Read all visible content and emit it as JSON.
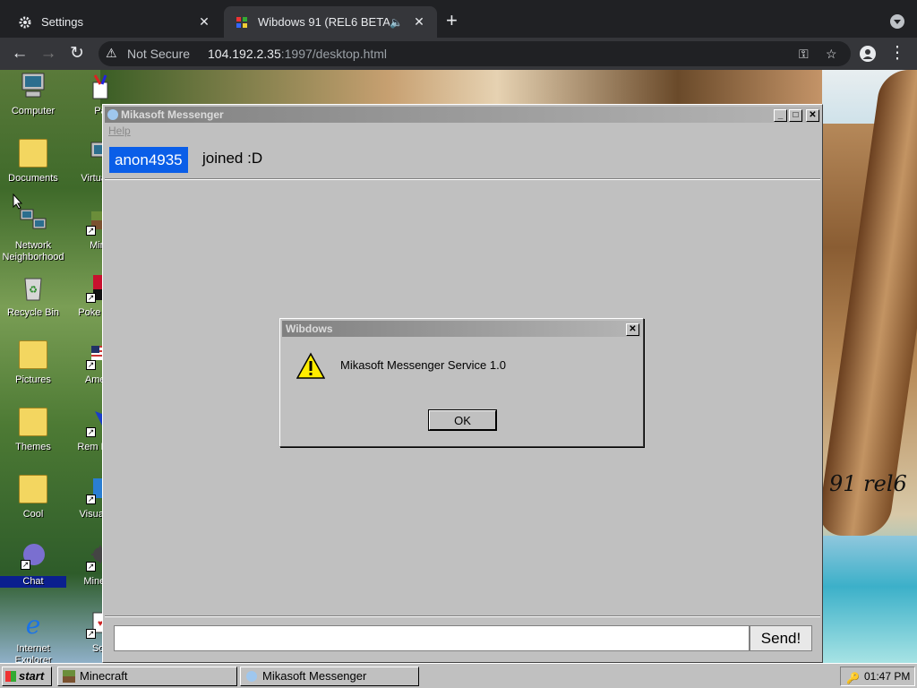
{
  "browser": {
    "tabs": [
      {
        "title": "Settings",
        "icon": "gear-icon"
      },
      {
        "title": "Wibdows 91 (REL6 BETA!)",
        "icon": "favicon-icon"
      }
    ],
    "security_label": "Not Secure",
    "url_host": "104.192.2.35",
    "url_rest": ":1997/desktop.html"
  },
  "desktop": {
    "brand_text": "91 rel6",
    "icons_col1": [
      {
        "label": "Computer",
        "selected": false
      },
      {
        "label": "Documents",
        "selected": false
      },
      {
        "label": "Network Neighborhood",
        "selected": false
      },
      {
        "label": "Recycle Bin",
        "selected": false
      },
      {
        "label": "Pictures",
        "selected": false
      },
      {
        "label": "Themes",
        "selected": false
      },
      {
        "label": "Cool",
        "selected": false
      },
      {
        "label": "Chat",
        "selected": true
      },
      {
        "label": "Internet Explorer",
        "selected": false
      }
    ],
    "icons_col2": [
      {
        "label": "Pa"
      },
      {
        "label": "Virtual M"
      },
      {
        "label": "Mine"
      },
      {
        "label": "Poke Plati"
      },
      {
        "label": "Americ"
      },
      {
        "label": "Rem Desk"
      },
      {
        "label": "Visual Co"
      },
      {
        "label": "Minesw"
      },
      {
        "label": "Soli"
      }
    ]
  },
  "messenger": {
    "title": "Mikasoft Messenger",
    "menu_help": "Help",
    "username": "anon4935",
    "join_message": "joined :D",
    "input_value": "",
    "send_label": "Send!"
  },
  "dialog": {
    "title": "Wibdows",
    "message": "Mikasoft Messenger Service 1.0",
    "ok_label": "OK"
  },
  "taskbar": {
    "start_label": "start",
    "tasks": [
      {
        "label": "Minecraft"
      },
      {
        "label": "Mikasoft Messenger"
      }
    ],
    "clock": "01:47 PM"
  }
}
